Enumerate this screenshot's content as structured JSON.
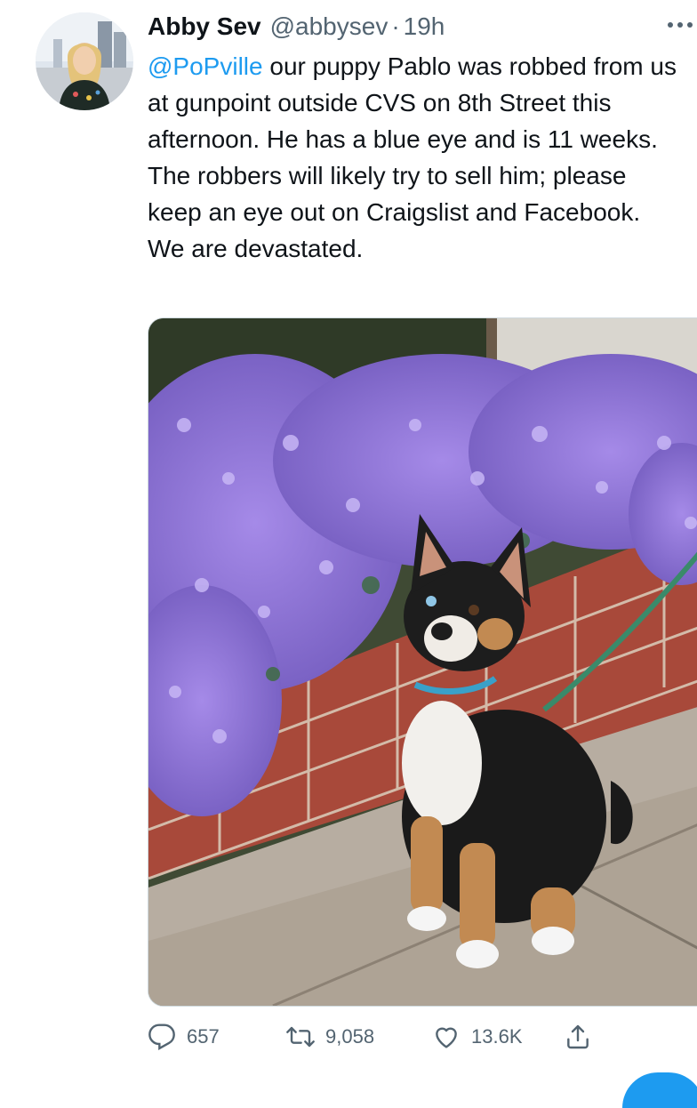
{
  "tweet": {
    "author_name": "Abby Sev",
    "author_handle": "@abbysev",
    "separator": "·",
    "time": "19h",
    "mention": "@PoPville",
    "text": " our puppy Pablo was robbed from us at gunpoint outside CVS on 8th Street this afternoon. He has a blue eye and is 11 weeks. The robbers will likely try to sell him; please keep an eye out on Craigslist and Facebook. We are devastated.",
    "photo_icon": "puppy-photo"
  },
  "actions": {
    "replies": "657",
    "retweets": "9,058",
    "likes": "13.6K"
  },
  "icons": {
    "reply": "reply-icon",
    "retweet": "retweet-icon",
    "like": "heart-icon",
    "share": "share-icon",
    "more": "more-icon"
  },
  "colors": {
    "link": "#1d9bf0",
    "secondary_text": "#536471",
    "primary_text": "#0f1419"
  }
}
